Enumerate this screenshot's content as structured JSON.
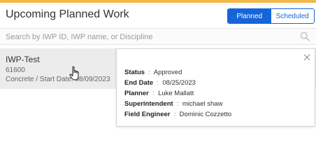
{
  "header": {
    "title": "Upcoming Planned Work",
    "toggle": {
      "planned_label": "Planned",
      "scheduled_label": "Scheduled",
      "selected": "Planned"
    }
  },
  "search": {
    "placeholder": "Search by IWP ID, IWP name, or Discipline",
    "value": ""
  },
  "work_item": {
    "name": "IWP-Test",
    "code": "61600",
    "meta": "Concrete / Start Date: 08/09/2023"
  },
  "details_popup": {
    "fields": [
      {
        "label": "Status",
        "value": "Approved"
      },
      {
        "label": "End Date",
        "value": "08/25/2023"
      },
      {
        "label": "Planner",
        "value": "Luke Mallatt"
      },
      {
        "label": "Superintendent",
        "value": "michael shaw"
      },
      {
        "label": "Field Engineer",
        "value": "Dominic Cozzetto"
      }
    ]
  },
  "colors": {
    "accent": "#f2b84b",
    "primary": "#1565d8",
    "card_bg": "#ececec"
  }
}
